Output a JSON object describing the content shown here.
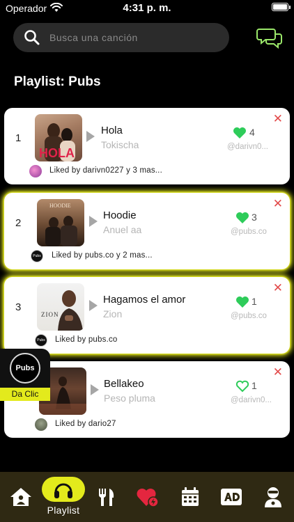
{
  "status_bar": {
    "carrier": "Operador",
    "time": "4:31 p. m."
  },
  "search": {
    "placeholder": "Busca una canción"
  },
  "page_title": "Playlist: Pubs",
  "songs": [
    {
      "rank": "1",
      "title": "Hola",
      "artist": "Tokischa",
      "likes": "4",
      "liked": true,
      "handle": "@darivn0...",
      "liked_by": "Liked by darivn0227 y 3 mas...",
      "cover_text": "HOLA"
    },
    {
      "rank": "2",
      "title": "Hoodie",
      "artist": "Anuel aa",
      "likes": "3",
      "liked": true,
      "handle": "@pubs.co",
      "liked_by": "Liked by pubs.co y 2 mas...",
      "cover_text": "HOODIE"
    },
    {
      "rank": "3",
      "title": "Hagamos el amor",
      "artist": "Zion",
      "likes": "1",
      "liked": true,
      "handle": "@pubs.co",
      "liked_by": "Liked by pubs.co",
      "cover_text": "ZION"
    },
    {
      "rank": "",
      "title": "Bellakeo",
      "artist": "Peso pluma",
      "likes": "1",
      "liked": false,
      "handle": "@darivn0...",
      "liked_by": "Liked by dario27",
      "cover_text": ""
    }
  ],
  "pubs_button": {
    "logo": "Pubs",
    "label": "Da Clic"
  },
  "nav": {
    "items": [
      "home-icon",
      "headphones-icon",
      "utensils-icon",
      "heart-bolt-icon",
      "calendar-icon",
      "ad-icon",
      "profile-icon"
    ],
    "active_label": "Playlist"
  },
  "colors": {
    "accent": "#e3ea1c",
    "heart": "#2ecc5a",
    "close": "#e24a4a",
    "nav_bg": "#2f2913"
  }
}
